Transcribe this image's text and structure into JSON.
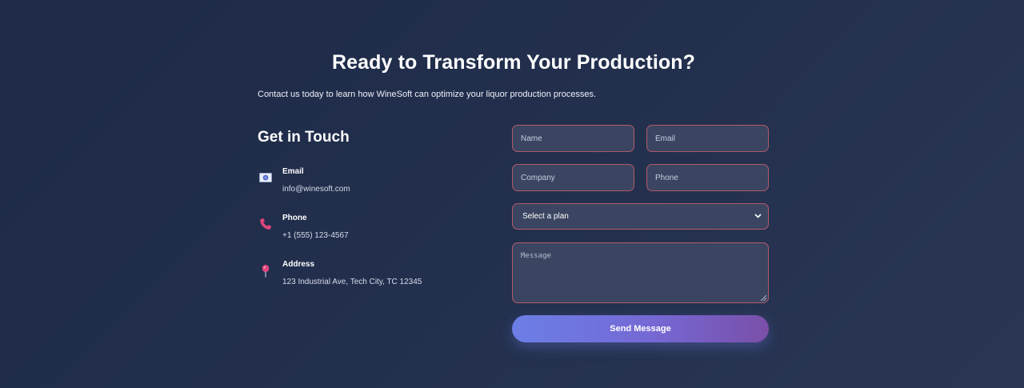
{
  "header": {
    "title": "Ready to Transform Your Production?",
    "subtitle": "Contact us today to learn how WineSoft can optimize your liquor production processes."
  },
  "contact": {
    "heading": "Get in Touch",
    "items": [
      {
        "label": "Email",
        "value": "info@winesoft.com",
        "icon": "envelope-icon"
      },
      {
        "label": "Phone",
        "value": "+1 (555) 123-4567",
        "icon": "phone-icon"
      },
      {
        "label": "Address",
        "value": "123 Industrial Ave, Tech City, TC 12345",
        "icon": "map-pin-icon"
      }
    ]
  },
  "form": {
    "name_placeholder": "Name",
    "email_placeholder": "Email",
    "company_placeholder": "Company",
    "phone_placeholder": "Phone",
    "plan_selected": "Select a plan",
    "message_placeholder": "Message",
    "submit_label": "Send Message"
  },
  "colors": {
    "background": "#222f4d",
    "field_bg": "#3b4561",
    "field_border": "#b25a6a",
    "button_start": "#6b7fe6",
    "button_end": "#7a4fa8",
    "icon_accent": "#e0457b"
  }
}
